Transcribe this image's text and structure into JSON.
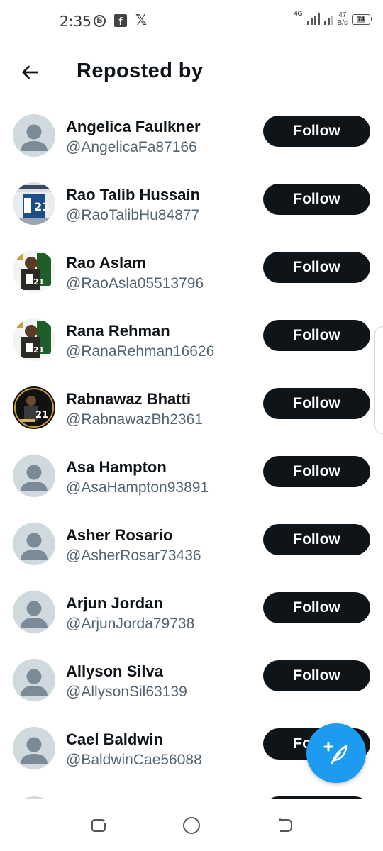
{
  "status_bar": {
    "time": "2:35",
    "notification_icons": [
      "b-circle-icon",
      "facebook-icon",
      "x-icon"
    ],
    "network": "4G",
    "speed_value": "47",
    "speed_unit": "B/s",
    "battery": "74"
  },
  "header": {
    "title": "Reposted by",
    "back_icon": "arrow-left-icon"
  },
  "users": [
    {
      "name": "Angelica Faulkner",
      "handle": "@AngelicaFa87166",
      "button": "Follow",
      "avatar": "default"
    },
    {
      "name": "Rao Talib Hussain",
      "handle": "@RaoTalibHu84877",
      "button": "Follow",
      "avatar": "photo-welcome-21"
    },
    {
      "name": "Rao Aslam",
      "handle": "@RaoAsla05513796",
      "button": "Follow",
      "avatar": "photo-green-21"
    },
    {
      "name": "Rana Rehman",
      "handle": "@RanaRehman16626",
      "button": "Follow",
      "avatar": "photo-green-21"
    },
    {
      "name": "Rabnawaz Bhatti",
      "handle": "@RabnawazBh2361",
      "button": "Follow",
      "avatar": "photo-dark-21"
    },
    {
      "name": "Asa Hampton",
      "handle": "@AsaHampton93891",
      "button": "Follow",
      "avatar": "default"
    },
    {
      "name": "Asher Rosario",
      "handle": "@AsherRosar73436",
      "button": "Follow",
      "avatar": "default"
    },
    {
      "name": "Arjun Jordan",
      "handle": "@ArjunJorda79738",
      "button": "Follow",
      "avatar": "default"
    },
    {
      "name": "Allyson Silva",
      "handle": "@AllysonSil63139",
      "button": "Follow",
      "avatar": "default"
    },
    {
      "name": "Cael Baldwin",
      "handle": "@BaldwinCae56088",
      "button": "Follow",
      "avatar": "default"
    }
  ],
  "fab": {
    "icon": "compose-plus-feather-icon"
  },
  "colors": {
    "button_bg": "#0f1419",
    "button_text": "#ffffff",
    "handle_text": "#536471",
    "fab_bg": "#1d9bf0",
    "default_avatar_bg": "#cfd9de",
    "default_avatar_fg": "#7b8a97"
  },
  "nav_bar": {
    "buttons": [
      "recents-icon",
      "home-circle-icon",
      "back-icon"
    ]
  }
}
